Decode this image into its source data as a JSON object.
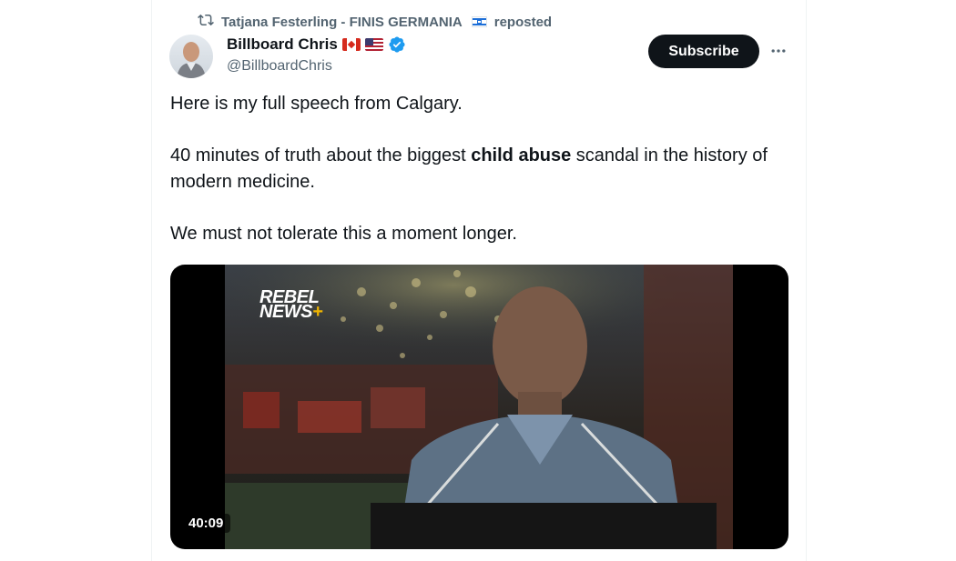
{
  "repost": {
    "text": "Tatjana Festerling - FINIS GERMANIA",
    "suffix": "reposted",
    "icon": "repost-icon"
  },
  "author": {
    "name": "Billboard Chris",
    "handle": "@BillboardChris",
    "flags": [
      "canada-flag",
      "us-flag"
    ],
    "verified": true,
    "verified_color": "#1d9bf0"
  },
  "actions": {
    "subscribe_label": "Subscribe",
    "more_icon": "more-icon"
  },
  "tweet": {
    "line1": "Here is my full speech from Calgary.",
    "line2_pre": "40 minutes of truth about the biggest ",
    "line2_bold": "child abuse",
    "line2_post": " scandal in the history of modern medicine.",
    "line3": "We must not tolerate this a moment longer."
  },
  "video": {
    "logo_line1": "REBEL",
    "logo_line2": "NEWS",
    "logo_plus": "+",
    "duration": "40:09"
  },
  "colors": {
    "text_primary": "#0f1419",
    "text_secondary": "#536471",
    "button_bg": "#0f1419",
    "accent": "#1d9bf0"
  }
}
